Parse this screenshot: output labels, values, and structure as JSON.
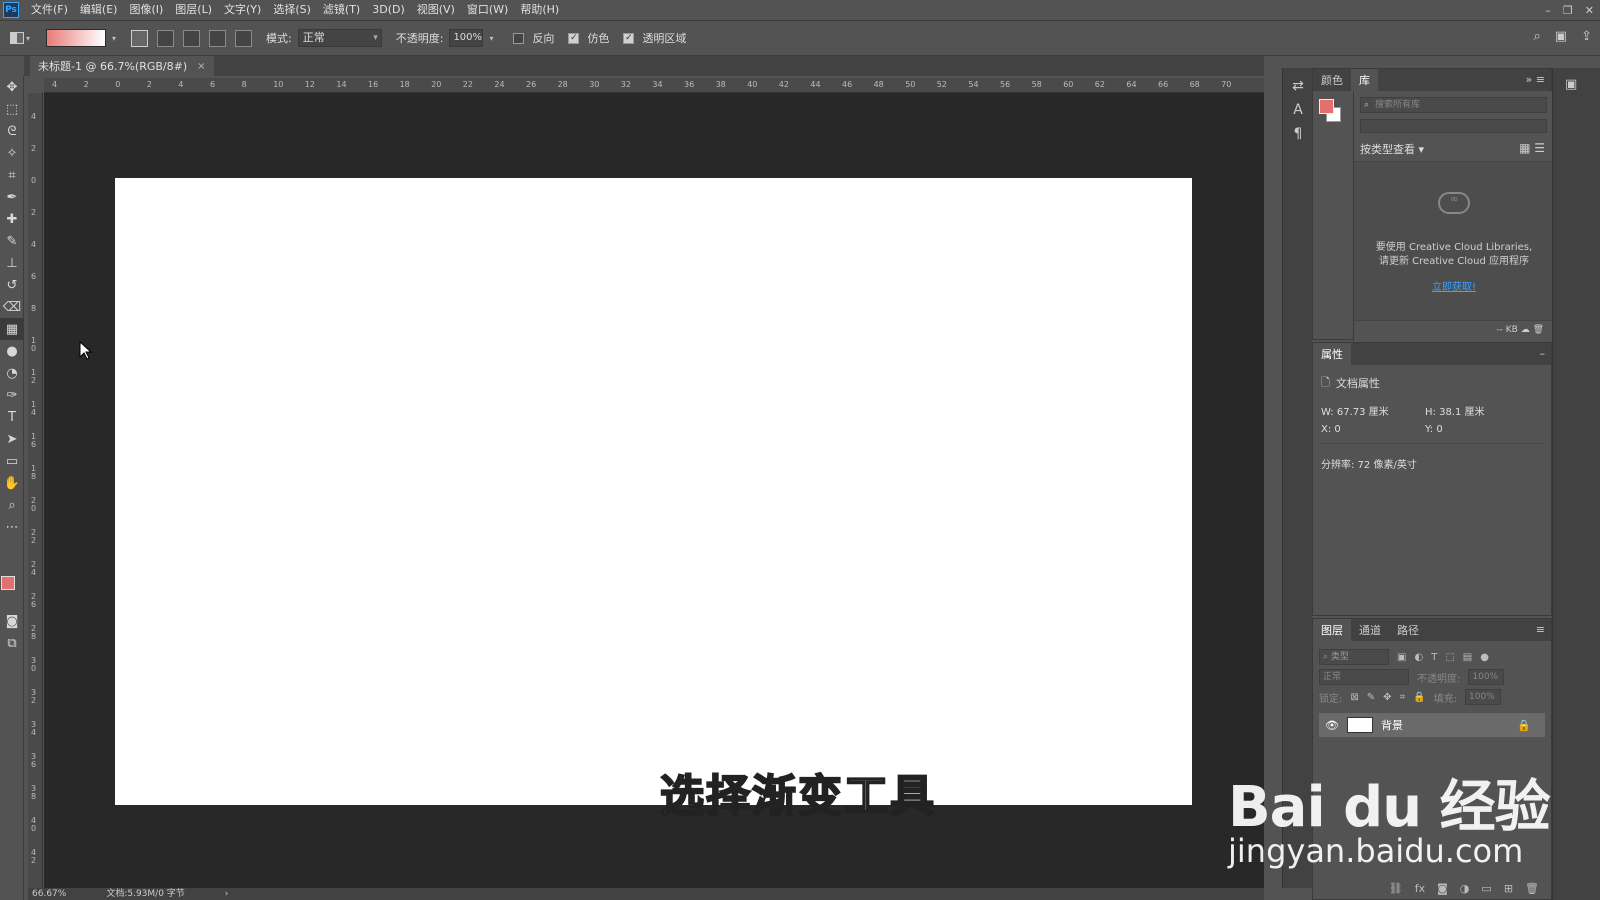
{
  "app": {
    "logo": "Ps"
  },
  "menu": [
    "文件(F)",
    "编辑(E)",
    "图像(I)",
    "图层(L)",
    "文字(Y)",
    "选择(S)",
    "滤镜(T)",
    "3D(D)",
    "视图(V)",
    "窗口(W)",
    "帮助(H)"
  ],
  "window_controls": [
    "–",
    "❐",
    "✕"
  ],
  "options": {
    "mode_label": "模式:",
    "mode_value": "正常",
    "opacity_label": "不透明度:",
    "opacity_value": "100%",
    "reverse_label": "反向",
    "reverse_checked": false,
    "dither_label": "仿色",
    "dither_checked": true,
    "transparency_label": "透明区域",
    "transparency_checked": true,
    "gradient_start_color": "#e97b7b",
    "gradient_end_color": "#ffffff"
  },
  "document": {
    "tab_title": "未标题-1 @ 66.7%(RGB/8#)",
    "close": "×",
    "zoom": "66.67%",
    "doc_info": "文档:5.93M/0 字节",
    "arrow": "›"
  },
  "ruler_h": [
    "4",
    "2",
    "0",
    "2",
    "4",
    "6",
    "8",
    "10",
    "12",
    "14",
    "16",
    "18",
    "20",
    "22",
    "24",
    "26",
    "28",
    "30",
    "32",
    "34",
    "36",
    "38",
    "40",
    "42",
    "44",
    "46",
    "48",
    "50",
    "52",
    "54",
    "56",
    "58",
    "60",
    "62",
    "64",
    "66",
    "68",
    "70"
  ],
  "ruler_v": [
    "4",
    "2",
    "0",
    "2",
    "4",
    "6",
    "8",
    "10",
    "12",
    "14",
    "16",
    "18",
    "20",
    "22",
    "24",
    "26",
    "28",
    "30",
    "32",
    "34",
    "36",
    "38",
    "40",
    "42"
  ],
  "colors": {
    "foreground": "#e56f6f",
    "background": "#ffffff",
    "canvas": "#ffffff",
    "workspace": "#282828"
  },
  "library_panel": {
    "tabs": [
      "颜色",
      "库"
    ],
    "active_tab": "库",
    "search_placeholder": "搜索所有库",
    "view_label": "按类型查看",
    "message_line1": "要使用 Creative Cloud Libraries,",
    "message_line2": "请更新 Creative Cloud 应用程序",
    "link": "立即获取!",
    "footer": "-- KB"
  },
  "properties_panel": {
    "tab": "属性",
    "doc_props_label": "文档属性",
    "w_label": "W:",
    "w_value": "67.73 厘米",
    "h_label": "H:",
    "h_value": "38.1 厘米",
    "x_label": "X:",
    "x_value": "0",
    "y_label": "Y:",
    "y_value": "0",
    "resolution": "分辨率: 72 像素/英寸"
  },
  "layers_panel": {
    "tabs": [
      "图层",
      "通道",
      "路径"
    ],
    "active_tab": "图层",
    "filter_placeholder": "类型",
    "blend_mode": "正常",
    "opacity_label": "不透明度:",
    "opacity_value": "100%",
    "lock_label": "锁定:",
    "fill_label": "填充:",
    "fill_value": "100%",
    "layer_name": "背景"
  },
  "overlay": {
    "subtitle": "选择渐变工具",
    "watermark_brand": "Bai du 经验",
    "watermark_url": "jingyan.baidu.com"
  }
}
